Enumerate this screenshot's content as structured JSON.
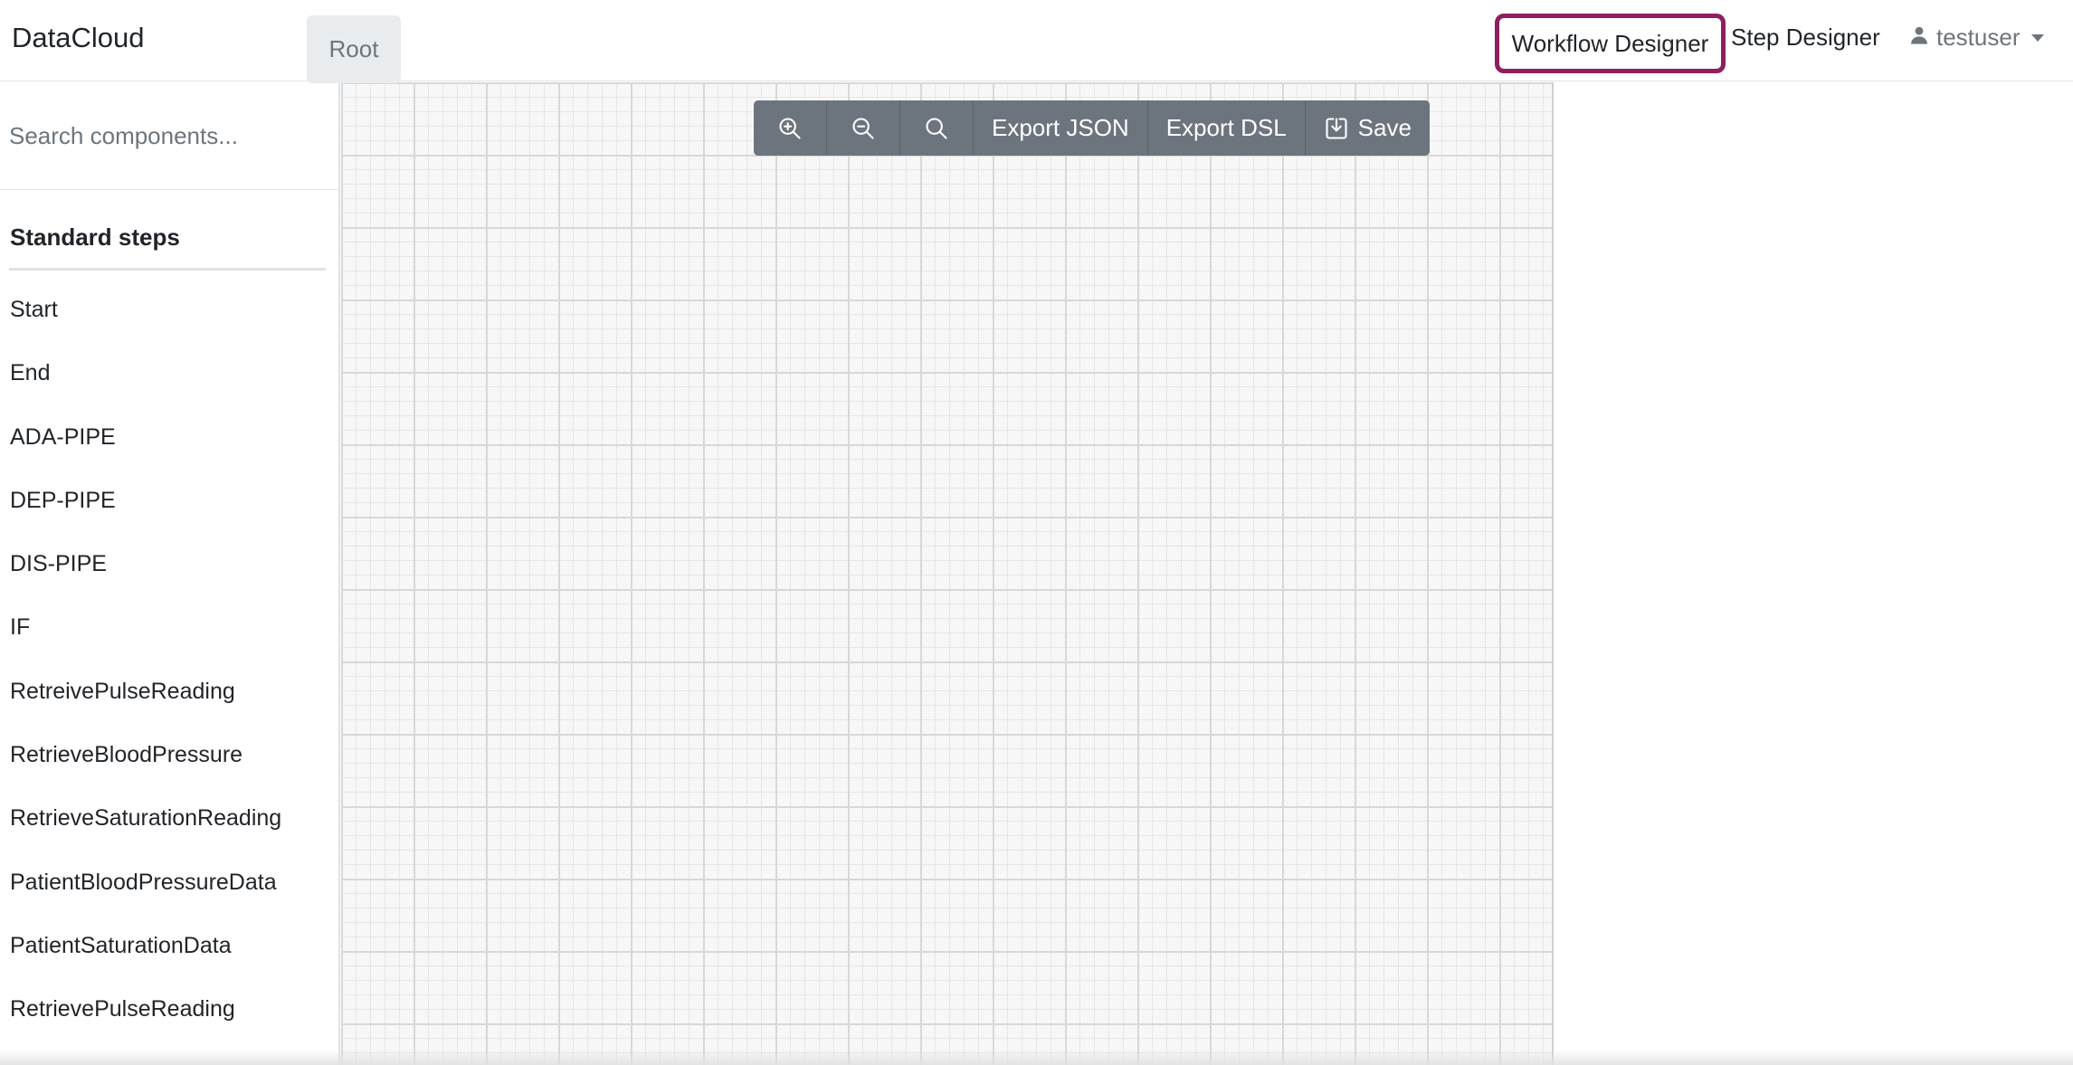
{
  "navbar": {
    "brand": "DataCloud",
    "workflow_designer": "Workflow Designer",
    "step_designer": "Step Designer",
    "user": "testuser"
  },
  "sidebar": {
    "search_placeholder": "Search components...",
    "root_label": "Root",
    "section_title": "Standard steps",
    "items": [
      "Start",
      "End",
      "ADA-PIPE",
      "DEP-PIPE",
      "DIS-PIPE",
      "IF",
      "RetreivePulseReading",
      "RetrieveBloodPressure",
      "RetrieveSaturationReading",
      "PatientBloodPressureData",
      "PatientSaturationData",
      "RetrievePulseReading"
    ]
  },
  "toolbar": {
    "zoom_in_icon": "zoom-in-icon",
    "zoom_out_icon": "zoom-out-icon",
    "zoom_reset_icon": "search-icon",
    "export_json": "Export JSON",
    "export_dsl": "Export DSL",
    "save_icon": "save-icon",
    "save": "Save"
  },
  "colors": {
    "active_nav_outline": "#8e1f5e",
    "toolbar_bg": "#6c757d"
  }
}
